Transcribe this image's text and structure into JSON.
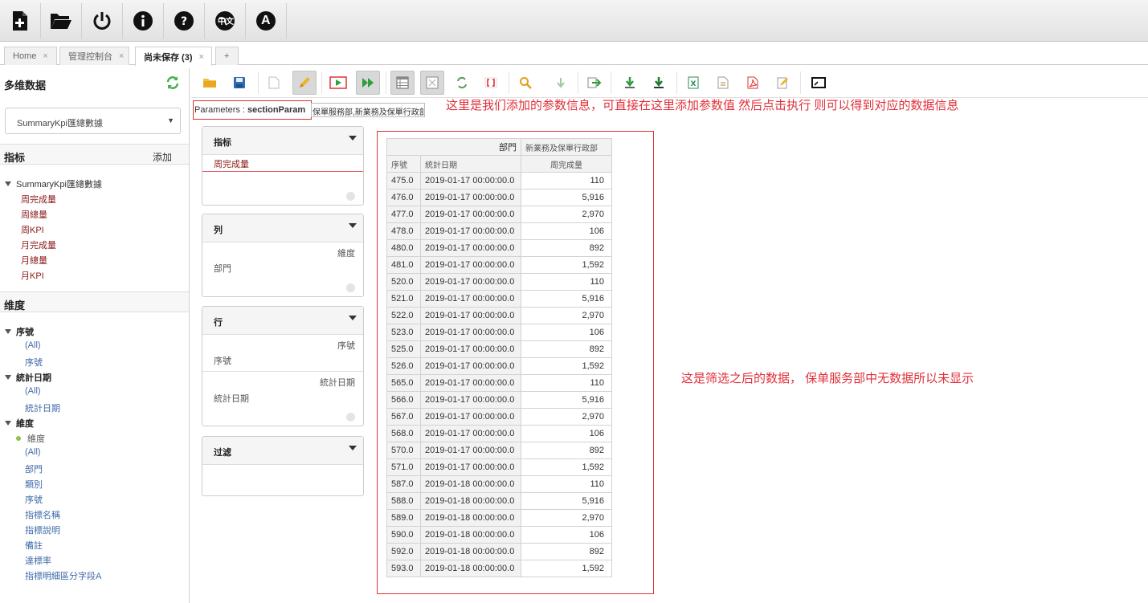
{
  "toolbar": {
    "buttons": [
      {
        "name": "new-query-button",
        "icon": "new-document-icon"
      },
      {
        "name": "open-button",
        "icon": "folder-icon"
      },
      {
        "name": "logout-button",
        "icon": "power-icon"
      },
      {
        "name": "about-button",
        "icon": "info-icon"
      },
      {
        "name": "help-button",
        "icon": "help-icon"
      },
      {
        "name": "language-button",
        "icon": "globe-icon",
        "label": "中文"
      },
      {
        "name": "admin-button",
        "icon": "letter-a-icon",
        "label": "A"
      }
    ]
  },
  "tabs": [
    {
      "label": "Home",
      "active": false
    },
    {
      "label": "管理控制台",
      "active": false
    },
    {
      "label": "尚未保存 (3)",
      "active": true
    }
  ],
  "tab_add_label": "+",
  "tab_close_glyph": "×",
  "left": {
    "title": "多维数据",
    "cube": "SummaryKpi匯總數據",
    "measures_header": "指标",
    "add_label": "添加",
    "measures_root": "SummaryKpi匯總數據",
    "measures": [
      "周完成量",
      "周總量",
      "周KPI",
      "月完成量",
      "月總量",
      "月KPI"
    ],
    "dimensions_header": "维度",
    "dimensions": [
      {
        "name": "序號",
        "items": [
          "(All)",
          "序號"
        ]
      },
      {
        "name": "統計日期",
        "items": [
          "(All)",
          "統計日期"
        ]
      },
      {
        "name": "維度",
        "selected": "維度",
        "items": [
          "(All)",
          "部門",
          "類別",
          "序號",
          "指標名稱",
          "指標說明",
          "備註",
          "達標率",
          "指標明細區分字段A"
        ]
      }
    ]
  },
  "parameters": {
    "label": "Parameters : ",
    "name": "sectionParam",
    "value": "保單服務部,新業務及保單行政部"
  },
  "annotations": {
    "top": "这里是我们添加的参数信息，可直接在这里添加参数值  然后点击执行  则可以得到对应的数据信息",
    "right": "这是筛选之后的数据，  保单服务部中无数据所以未显示"
  },
  "axes": {
    "measures": {
      "title": "指标",
      "items": [
        "周完成量"
      ]
    },
    "columns": {
      "title": "列",
      "levels": [
        {
          "label": "維度",
          "item": "部門"
        }
      ]
    },
    "rows": {
      "title": "行",
      "levels": [
        {
          "label": "序號",
          "item": "序號"
        },
        {
          "label": "統計日期",
          "item": "統計日期"
        }
      ]
    },
    "filter": {
      "title": "过滤"
    }
  },
  "table": {
    "col_dim_label": "部門",
    "col_member": "新業務及保單行政部",
    "row_headers": [
      "序號",
      "統計日期"
    ],
    "measure_header": "周完成量",
    "rows": [
      [
        "475.0",
        "2019-01-17 00:00:00.0",
        "110"
      ],
      [
        "476.0",
        "2019-01-17 00:00:00.0",
        "5,916"
      ],
      [
        "477.0",
        "2019-01-17 00:00:00.0",
        "2,970"
      ],
      [
        "478.0",
        "2019-01-17 00:00:00.0",
        "106"
      ],
      [
        "480.0",
        "2019-01-17 00:00:00.0",
        "892"
      ],
      [
        "481.0",
        "2019-01-17 00:00:00.0",
        "1,592"
      ],
      [
        "520.0",
        "2019-01-17 00:00:00.0",
        "110"
      ],
      [
        "521.0",
        "2019-01-17 00:00:00.0",
        "5,916"
      ],
      [
        "522.0",
        "2019-01-17 00:00:00.0",
        "2,970"
      ],
      [
        "523.0",
        "2019-01-17 00:00:00.0",
        "106"
      ],
      [
        "525.0",
        "2019-01-17 00:00:00.0",
        "892"
      ],
      [
        "526.0",
        "2019-01-17 00:00:00.0",
        "1,592"
      ],
      [
        "565.0",
        "2019-01-17 00:00:00.0",
        "110"
      ],
      [
        "566.0",
        "2019-01-17 00:00:00.0",
        "5,916"
      ],
      [
        "567.0",
        "2019-01-17 00:00:00.0",
        "2,970"
      ],
      [
        "568.0",
        "2019-01-17 00:00:00.0",
        "106"
      ],
      [
        "570.0",
        "2019-01-17 00:00:00.0",
        "892"
      ],
      [
        "571.0",
        "2019-01-17 00:00:00.0",
        "1,592"
      ],
      [
        "587.0",
        "2019-01-18 00:00:00.0",
        "110"
      ],
      [
        "588.0",
        "2019-01-18 00:00:00.0",
        "5,916"
      ],
      [
        "589.0",
        "2019-01-18 00:00:00.0",
        "2,970"
      ],
      [
        "590.0",
        "2019-01-18 00:00:00.0",
        "106"
      ],
      [
        "592.0",
        "2019-01-18 00:00:00.0",
        "892"
      ],
      [
        "593.0",
        "2019-01-18 00:00:00.0",
        "1,592"
      ]
    ]
  }
}
